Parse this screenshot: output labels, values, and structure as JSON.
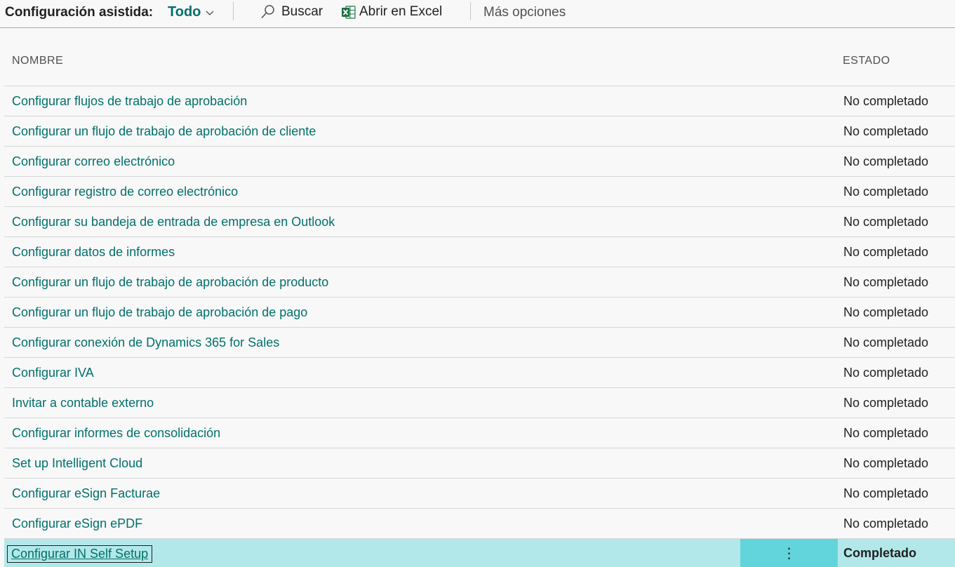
{
  "toolbar": {
    "title": "Configuración asistida:",
    "filter_label": "Todo",
    "filter_icon": "chevron-down-icon",
    "search_label": "Buscar",
    "search_icon": "search-icon",
    "excel_label": "Abrir en Excel",
    "excel_icon": "excel-icon",
    "more_label": "Más opciones"
  },
  "table": {
    "col_name": "NOMBRE",
    "col_status": "ESTADO",
    "rows": [
      {
        "name": "Configurar flujos de trabajo de aprobación",
        "status": "No completado"
      },
      {
        "name": "Configurar un flujo de trabajo de aprobación de cliente",
        "status": "No completado"
      },
      {
        "name": "Configurar correo electrónico",
        "status": "No completado"
      },
      {
        "name": "Configurar registro de correo electrónico",
        "status": "No completado"
      },
      {
        "name": "Configurar su bandeja de entrada de empresa en Outlook",
        "status": "No completado"
      },
      {
        "name": "Configurar datos de informes",
        "status": "No completado"
      },
      {
        "name": "Configurar un flujo de trabajo de aprobación de producto",
        "status": "No completado"
      },
      {
        "name": "Configurar un flujo de trabajo de aprobación de pago",
        "status": "No completado"
      },
      {
        "name": "Configurar conexión de Dynamics 365 for Sales",
        "status": "No completado"
      },
      {
        "name": "Configurar IVA",
        "status": "No completado"
      },
      {
        "name": "Invitar a contable externo",
        "status": "No completado"
      },
      {
        "name": "Configurar informes de consolidación",
        "status": "No completado"
      },
      {
        "name": "Set up Intelligent Cloud",
        "status": "No completado"
      },
      {
        "name": "Configurar eSign Facturae",
        "status": "No completado"
      },
      {
        "name": "Configurar eSign ePDF",
        "status": "No completado"
      }
    ],
    "selected_row": {
      "name": "Configurar IN Self Setup",
      "status": "Completado",
      "menu_icon": "more-vertical-icon"
    }
  },
  "colors": {
    "accent": "#00706b",
    "selected_row_bg": "#b3e8ea",
    "selected_cell_bg": "#62d4dc"
  }
}
